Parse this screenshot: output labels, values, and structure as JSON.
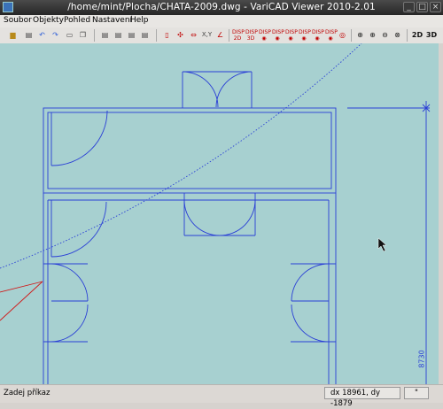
{
  "window": {
    "title": "/home/mint/Plocha/CHATA-2009.dwg - VariCAD Viewer 2010-2.01"
  },
  "menu": {
    "items": [
      "Soubor",
      "Objekty",
      "Pohled",
      "Nastavení",
      "Help"
    ]
  },
  "toolbar": {
    "view_2d": "2D",
    "view_3d": "3D",
    "disp_label": "DISP"
  },
  "drawing": {
    "dimension_text": "8730"
  },
  "status": {
    "command_prompt": "Zadej příkaz",
    "coordinates": "dx 18961, dy -1879",
    "units": "\""
  },
  "colors": {
    "canvas_bg": "#a7d0d0",
    "line": "#2a3fd6"
  }
}
